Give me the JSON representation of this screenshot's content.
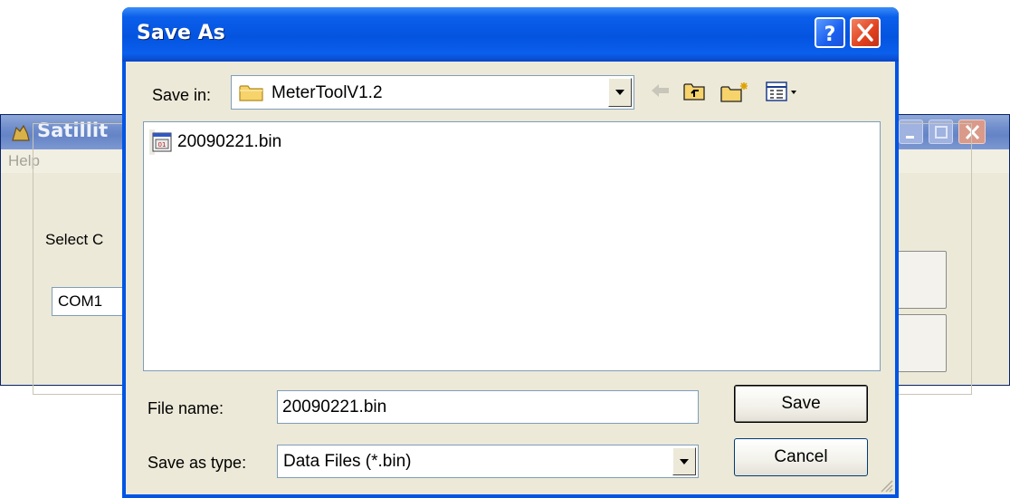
{
  "background_window": {
    "title": "Satillit",
    "menu_help": "Help",
    "group_label": "Select C",
    "port_value": "COM1"
  },
  "dialog": {
    "title": "Save As",
    "save_in_label": "Save in:",
    "save_in_value": "MeterToolV1.2",
    "files": [
      {
        "name": "20090221.bin",
        "icon": "bin-file-icon"
      }
    ],
    "file_name_label": "File name:",
    "file_name_value": "20090221.bin",
    "save_as_type_label": "Save as type:",
    "save_as_type_value": "Data Files (*.bin)",
    "save_label": "Save",
    "cancel_label": "Cancel"
  },
  "colors": {
    "titlebar": "#0454e0",
    "dialog_face": "#ece9d8",
    "close_button": "#e0401d"
  }
}
